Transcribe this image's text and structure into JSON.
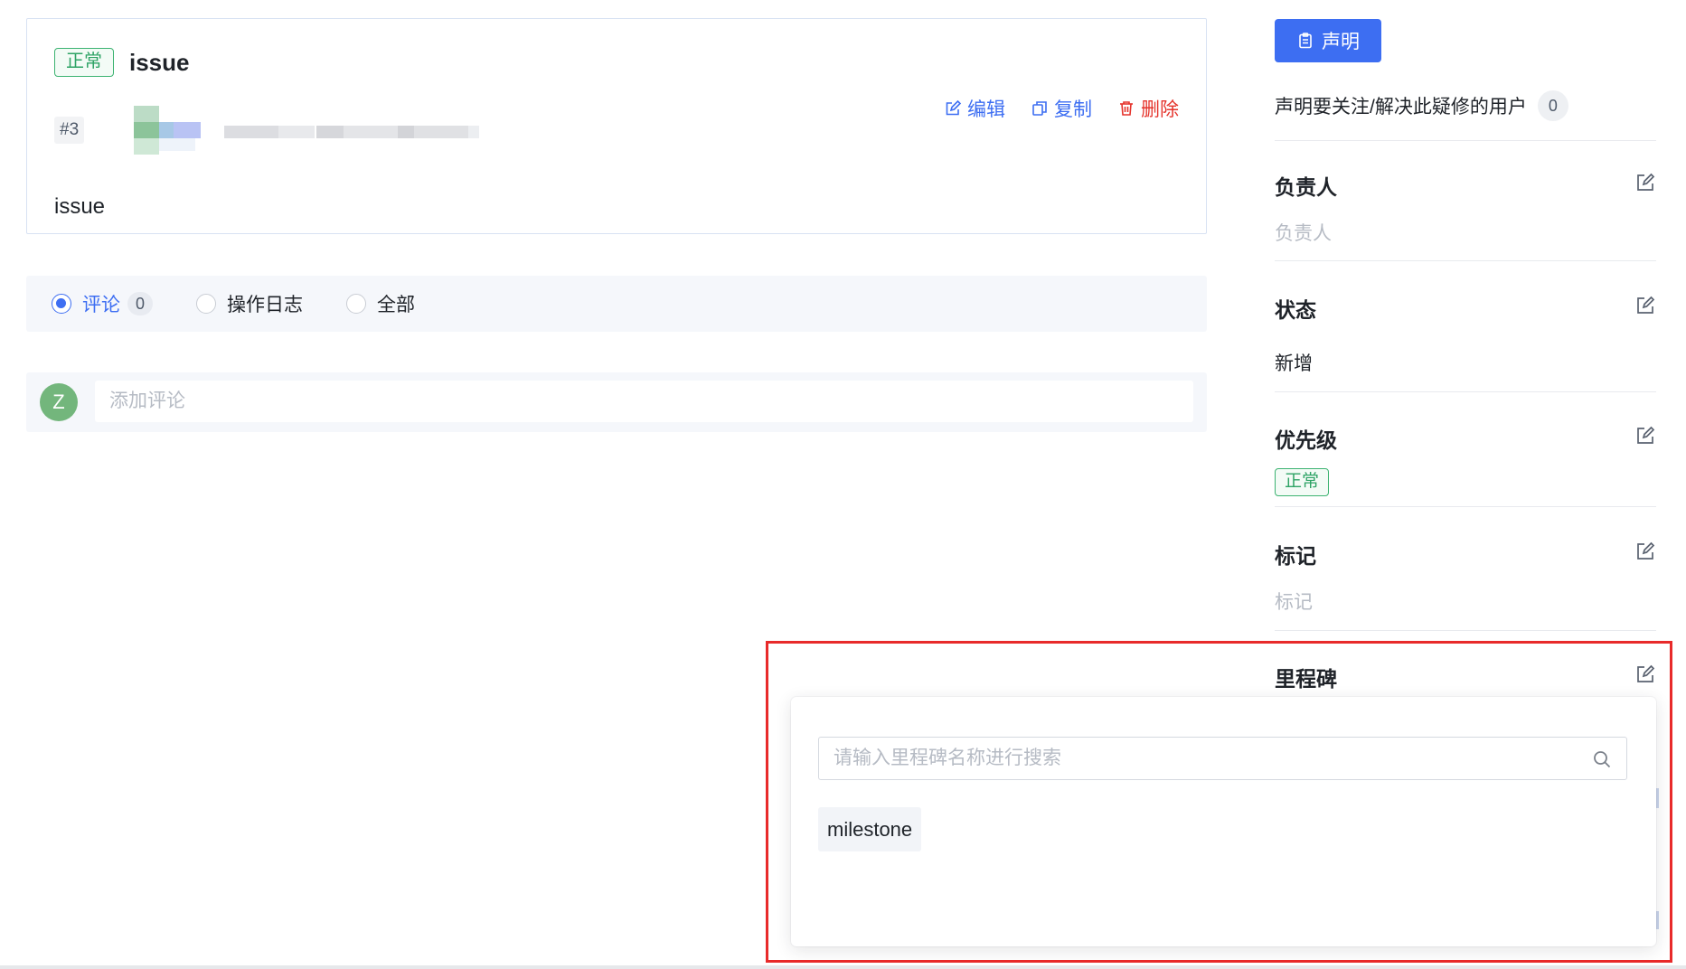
{
  "issue": {
    "priority_tag": "正常",
    "title": "issue",
    "number": "#3",
    "body": "issue",
    "actions": {
      "edit": "编辑",
      "copy": "复制",
      "delete": "删除"
    }
  },
  "filters": {
    "options": [
      {
        "label": "评论",
        "count": "0",
        "active": true
      },
      {
        "label": "操作日志"
      },
      {
        "label": "全部"
      }
    ]
  },
  "comment": {
    "avatar_initial": "Z",
    "placeholder": "添加评论"
  },
  "sidebar": {
    "claim_button": "声明",
    "claim_text": "声明要关注/解决此疑修的用户",
    "claim_count": "0",
    "assignee": {
      "title": "负责人",
      "value": "负责人"
    },
    "status": {
      "title": "状态",
      "value": "新增"
    },
    "priority": {
      "title": "优先级",
      "value": "正常"
    },
    "labels": {
      "title": "标记",
      "value": "标记"
    },
    "milestone": {
      "title": "里程碑"
    }
  },
  "milestone_dropdown": {
    "search_placeholder": "请输入里程碑名称进行搜索",
    "options": [
      "milestone"
    ]
  },
  "colors": {
    "primary": "#3d6ef2",
    "success": "#2ea365",
    "danger": "#e5342c",
    "highlight": "#e82a2a"
  },
  "icons": [
    "edit-icon",
    "copy-icon",
    "delete-icon",
    "clipboard-icon",
    "search-icon"
  ]
}
